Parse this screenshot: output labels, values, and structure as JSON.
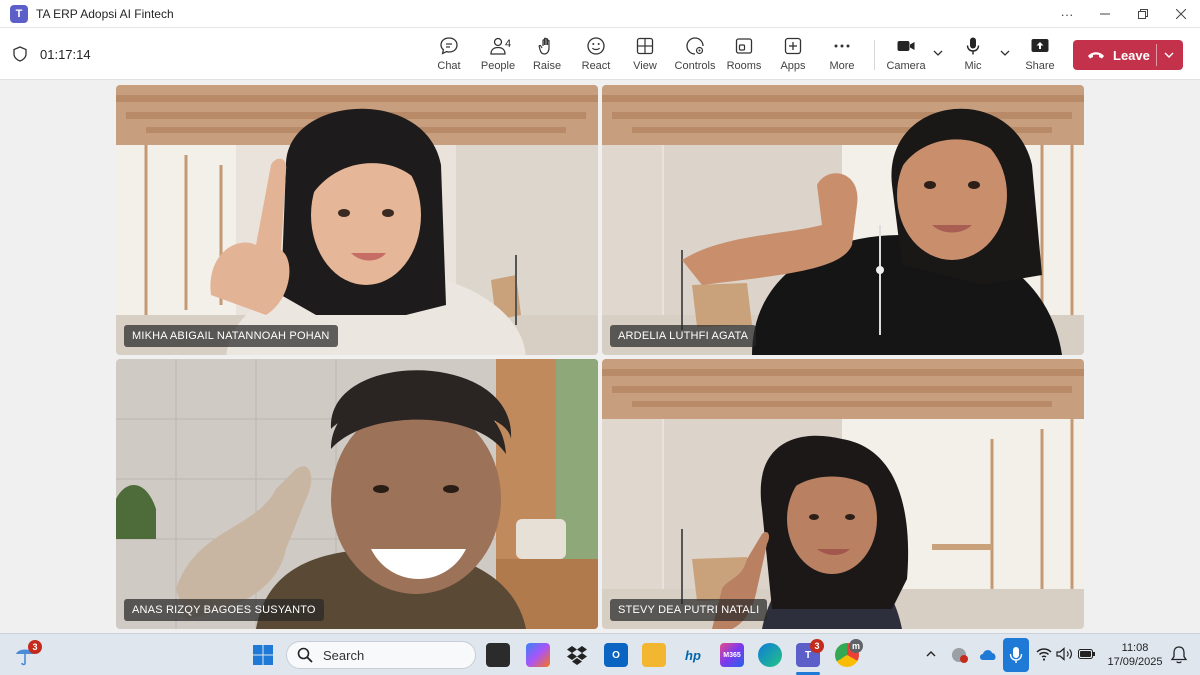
{
  "window": {
    "title": "TA ERP Adopsi AI Fintech",
    "logo_text": "T"
  },
  "meeting": {
    "timer": "01:17:14",
    "people_count": "4",
    "toolbar": {
      "chat": "Chat",
      "people": "People",
      "raise": "Raise",
      "react": "React",
      "view": "View",
      "controls": "Controls",
      "rooms": "Rooms",
      "apps": "Apps",
      "more": "More",
      "camera": "Camera",
      "mic": "Mic",
      "share": "Share",
      "leave": "Leave"
    }
  },
  "participants": [
    {
      "name": "MIKHA ABIGAIL NATANNOAH POHAN"
    },
    {
      "name": "ARDELIA LUTHFI AGATA"
    },
    {
      "name": "ANAS RIZQY BAGOES SUSYANTO"
    },
    {
      "name": "STEVY DEA PUTRI NATALI"
    }
  ],
  "taskbar": {
    "search_placeholder": "Search",
    "weather_badge": "3",
    "teams_badge": "3",
    "chrome_badge": "m",
    "m365_label": "M365",
    "hp_label": "hp",
    "time": "11:08",
    "date": "17/09/2025"
  },
  "colors": {
    "leave": "#c4314b",
    "teams_purple": "#5b5fc7",
    "taskbar": "#dfe6ee"
  }
}
